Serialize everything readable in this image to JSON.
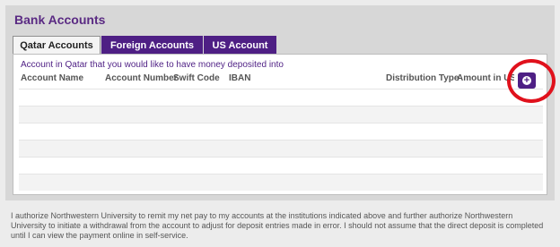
{
  "page": {
    "title": "Bank Accounts"
  },
  "tabs": [
    {
      "label": "Qatar Accounts",
      "active": true
    },
    {
      "label": "Foreign Accounts",
      "active": false
    },
    {
      "label": "US Account",
      "active": false
    }
  ],
  "panel": {
    "description": "Account in Qatar that you would like to have money deposited into",
    "columns": [
      "Account Name",
      "Account Number",
      "Swift Code",
      "IBAN",
      "Distribution Type",
      "Amount in USD"
    ],
    "rows": []
  },
  "add_button": {
    "icon": "plus-circle-icon"
  },
  "footer": {
    "text": "I authorize Northwestern University to remit my net pay to my accounts at the institutions indicated above and further authorize Northwestern University to initiate a withdrawal from the account to adjust for deposit entries made in error. I should not assume that the direct deposit is completed until I can view the payment online in self-service."
  },
  "colors": {
    "accent": "#4e1f84",
    "highlight": "#e0111c",
    "panel_bg": "#d7d7d7"
  }
}
